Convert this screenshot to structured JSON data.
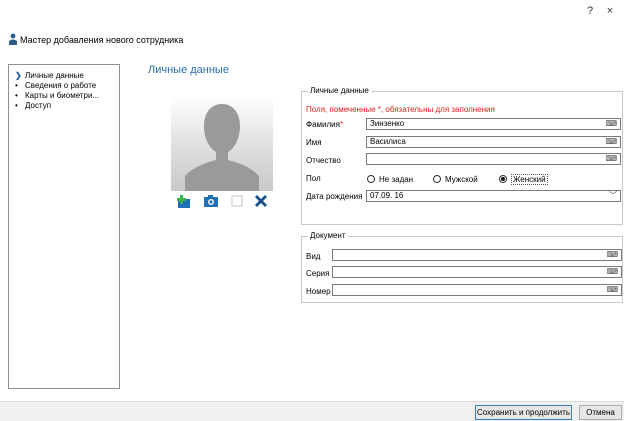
{
  "window": {
    "help_label": "?",
    "close_label": "×"
  },
  "wizard": {
    "title": "Мастер добавления нового сотрудника"
  },
  "nav": {
    "items": [
      {
        "label": "Личные данные",
        "active": true
      },
      {
        "label": "Сведения о работе",
        "active": false
      },
      {
        "label": "Карты и биометри...",
        "active": false
      },
      {
        "label": "Доступ",
        "active": false
      }
    ]
  },
  "section": {
    "title": "Личные данные"
  },
  "personal": {
    "legend": "Личные данные",
    "required_note": "Поля, помеченные *, обязательны для заполнения",
    "surname_label": "Фамилия",
    "required_mark": "*",
    "surname_value": "Зинзенко",
    "name_label": "Имя",
    "name_value": "Василиса",
    "patronymic_label": "Отчество",
    "patronymic_value": "",
    "gender_label": "Пол",
    "gender_options": [
      "Не задан",
      "Мужской",
      "Женский"
    ],
    "gender_selected": "Женский",
    "birthdate_label": "Дата рождения",
    "birthdate_value": "07.09. 16"
  },
  "document": {
    "legend": "Документ",
    "type_label": "Вид",
    "series_label": "Серия",
    "number_label": "Номер"
  },
  "footer": {
    "save_label": "Сохранить и продолжить",
    "cancel_label": "Отмена"
  },
  "colors": {
    "accent": "#2a6db0",
    "required": "#e0201a",
    "photo_add": "#1e6fb8",
    "photo_add_plus": "#3ab14a",
    "photo_delete": "#1a4f8c"
  }
}
